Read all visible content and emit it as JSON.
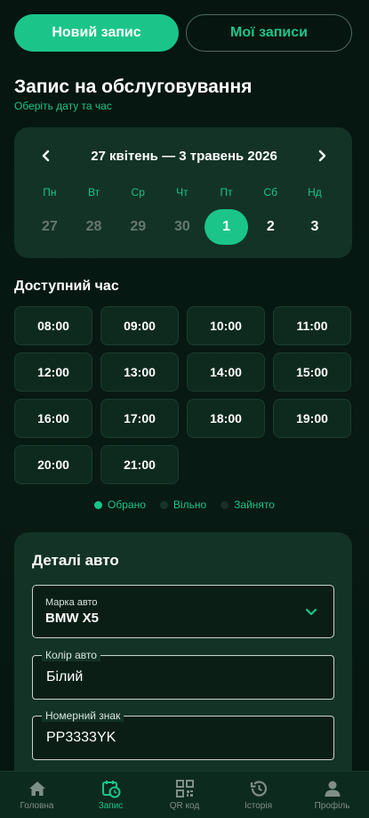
{
  "tabs": {
    "new_entry": "Новий запис",
    "my_entries": "Мої записи"
  },
  "header": {
    "title": "Запис на обслуговування",
    "subtitle": "Оберіть дату та час"
  },
  "calendar": {
    "range": "27 квітень — 3 травень 2026",
    "day_names": [
      "Пн",
      "Вт",
      "Ср",
      "Чт",
      "Пт",
      "Сб",
      "Нд"
    ],
    "dates": [
      "27",
      "28",
      "29",
      "30",
      "1",
      "2",
      "3"
    ],
    "selected": "1"
  },
  "time": {
    "title": "Доступний час",
    "slots": [
      "08:00",
      "09:00",
      "10:00",
      "11:00",
      "12:00",
      "13:00",
      "14:00",
      "15:00",
      "16:00",
      "17:00",
      "18:00",
      "19:00",
      "20:00",
      "21:00"
    ]
  },
  "legend": {
    "selected": "Обрано",
    "free": "Вільно",
    "busy": "Зайнято"
  },
  "car": {
    "title": "Деталі авто",
    "brand_label": "Марка авто",
    "brand_value": "BMW X5",
    "color_label": "Колір авто",
    "color_value": "Білий",
    "plate_label": "Номерний знак",
    "plate_value": "PP3333YK"
  },
  "nav": {
    "home": "Головна",
    "booking": "Запис",
    "qr": "QR код",
    "history": "Історія",
    "profile": "Профіль"
  },
  "colors": {
    "accent": "#1bc58a",
    "background": "#06140f",
    "card": "#133326"
  },
  "icons": [
    "chevron-left-icon",
    "chevron-right-icon",
    "chevron-down-icon",
    "home-icon",
    "calendar-clock-icon",
    "qr-code-icon",
    "history-icon",
    "user-icon"
  ]
}
